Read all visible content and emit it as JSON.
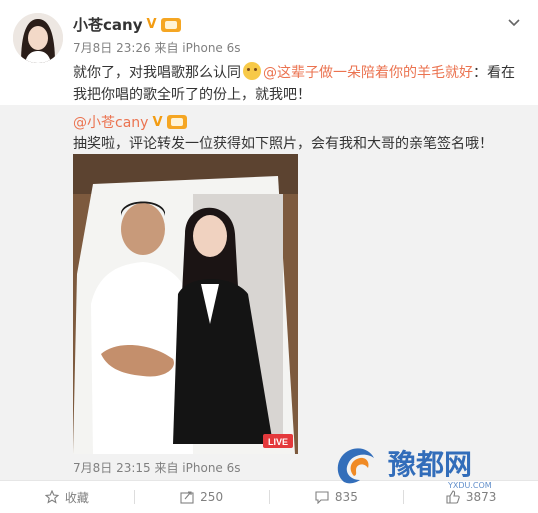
{
  "post": {
    "username": "小苍cany",
    "verified_mark": "V",
    "meta": "7月8日 23:26 来自 iPhone 6s",
    "text_before": "就你了，对我唱歌那么认同",
    "mention": "@这辈子做一朵陪着你的羊毛就好",
    "text_after": "：看在我把你唱的歌全听了的份上，就我吧！"
  },
  "repost": {
    "username": "@小苍cany",
    "verified_mark": "V",
    "text": "抽奖啦，评论转发一位获得如下照片，会有我和大哥的亲笔签名哦！",
    "photo_badge": "LIVE",
    "meta": "7月8日 23:15 来自 iPhone 6s"
  },
  "actions": {
    "favorite_label": "收藏",
    "repost_count": "250",
    "comment_count": "835",
    "like_count": "3873"
  },
  "watermark": {
    "brand": "豫都网",
    "url": "YXDU.COM"
  },
  "colors": {
    "mention": "#eb7350",
    "meta": "#808080",
    "repost_bg": "#f2f2f2"
  }
}
